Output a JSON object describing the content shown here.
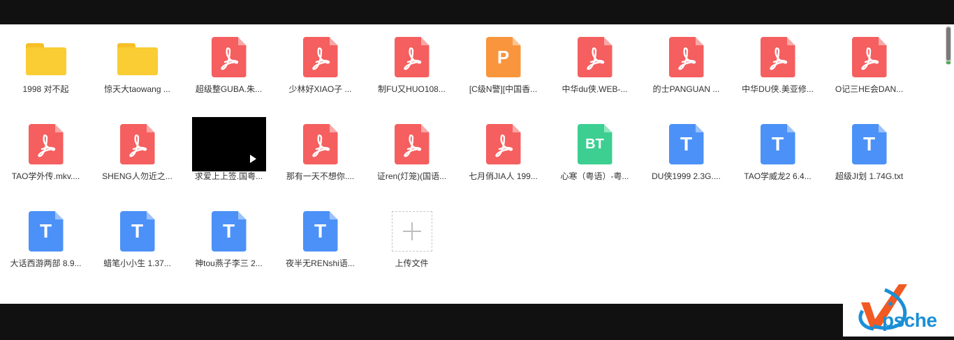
{
  "files": [
    {
      "type": "folder",
      "name": "1998 对不起"
    },
    {
      "type": "folder",
      "name": "惊天大taowang ..."
    },
    {
      "type": "pdf",
      "name": "超级整GUBA.朱..."
    },
    {
      "type": "pdf",
      "name": "少林好XIAO子 ..."
    },
    {
      "type": "pdf",
      "name": "制FU又HUO108..."
    },
    {
      "type": "ppt",
      "name": "[C级N警][中国香...",
      "glyph": "P"
    },
    {
      "type": "pdf",
      "name": "中华du侠.WEB-..."
    },
    {
      "type": "pdf",
      "name": "的士PANGUAN ..."
    },
    {
      "type": "pdf",
      "name": "中华DU侠.美亚修..."
    },
    {
      "type": "pdf",
      "name": "O记三HE会DAN..."
    },
    {
      "type": "pdf",
      "name": "TAO学外传.mkv...."
    },
    {
      "type": "pdf",
      "name": "SHENG人勿近之..."
    },
    {
      "type": "video",
      "name": "求爱上上签.国粤..."
    },
    {
      "type": "pdf",
      "name": "那有一天不想你...."
    },
    {
      "type": "pdf",
      "name": "证ren(灯笼)(国语..."
    },
    {
      "type": "pdf",
      "name": "七月俏JIA人 199..."
    },
    {
      "type": "bt",
      "name": "心寒（粤语）-粤...",
      "glyph": "BT"
    },
    {
      "type": "txt",
      "name": "DU侠1999 2.3G....",
      "glyph": "T"
    },
    {
      "type": "txt",
      "name": "TAO学威龙2 6.4...",
      "glyph": "T"
    },
    {
      "type": "txt",
      "name": "超级JI划 1.74G.txt",
      "glyph": "T"
    },
    {
      "type": "txt",
      "name": "大话西游两部 8.9...",
      "glyph": "T"
    },
    {
      "type": "txt",
      "name": "蜡笔小小生 1.37...",
      "glyph": "T"
    },
    {
      "type": "txt",
      "name": "神tou燕子李三 2...",
      "glyph": "T"
    },
    {
      "type": "txt",
      "name": "夜半无RENshi语...",
      "glyph": "T"
    }
  ],
  "upload": {
    "label": "上传文件"
  },
  "watermark": {
    "text": "psche"
  },
  "colors": {
    "pdf": "#f55f5f",
    "ppt": "#f9953d",
    "bt": "#3ccf91",
    "txt": "#4c91f7",
    "folder": "#f9cd33"
  }
}
